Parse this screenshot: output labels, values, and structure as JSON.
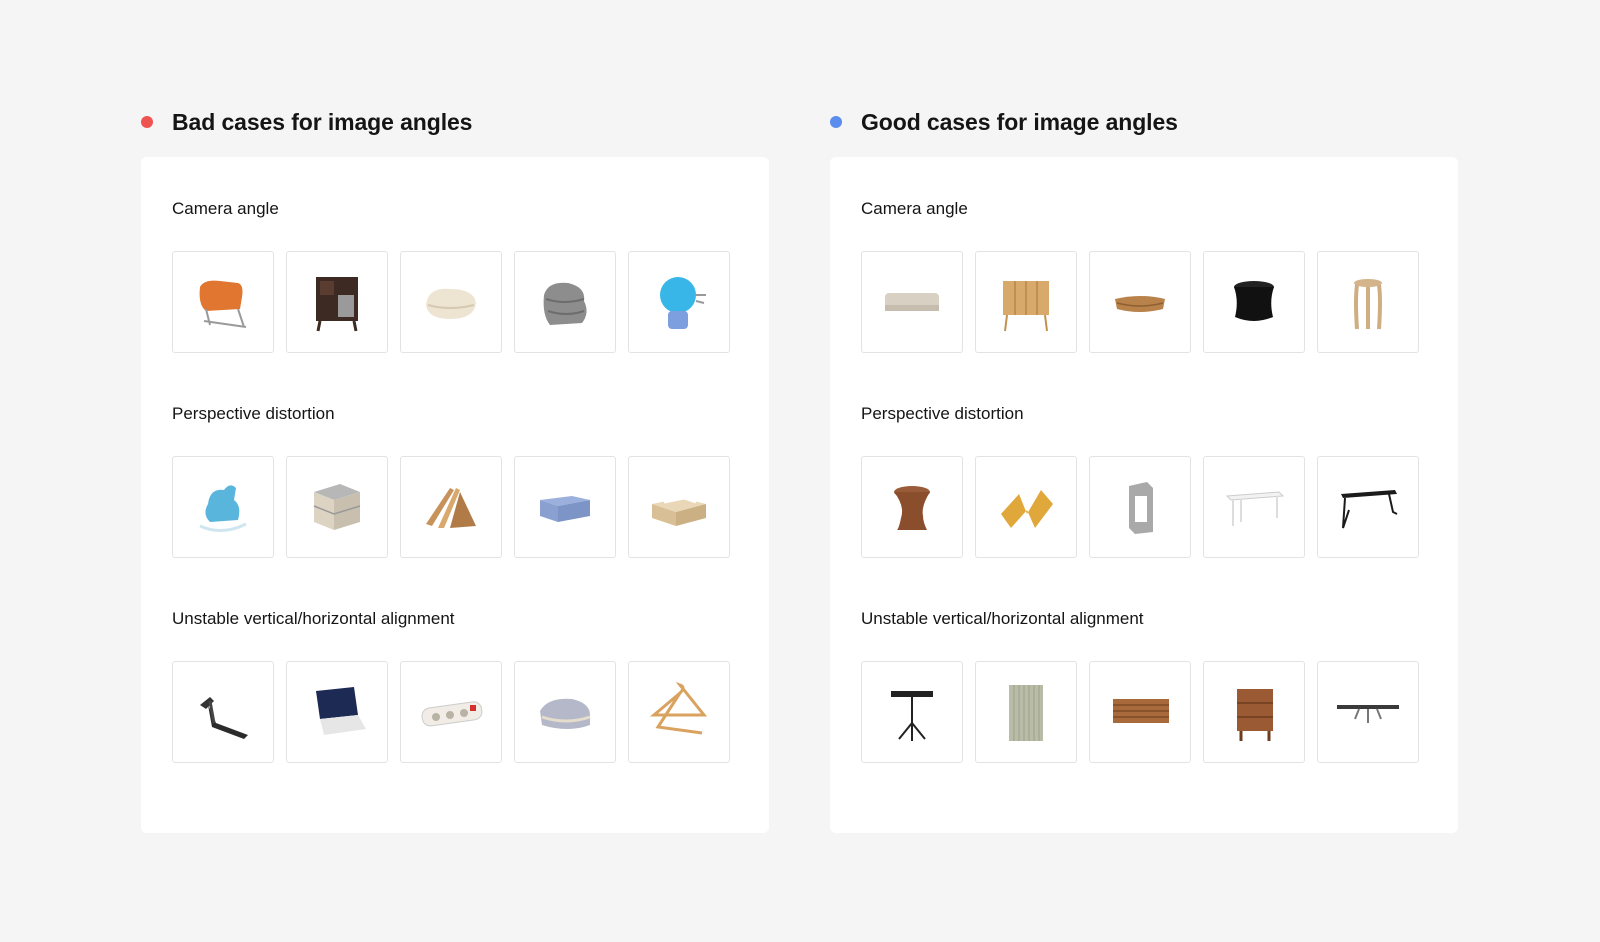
{
  "bad": {
    "title": "Bad cases for image angles",
    "dot_color": "#ef5350",
    "sections": [
      {
        "label": "Camera angle",
        "items": [
          "orange-lounge-chair-icon",
          "dark-wood-cabinet-icon",
          "folded-blanket-icon",
          "rolled-grey-blanket-icon",
          "blue-plugin-diffuser-icon"
        ]
      },
      {
        "label": "Perspective distortion",
        "items": [
          "blue-rocking-horse-icon",
          "mattress-stack-icon",
          "wood-planks-icon",
          "blue-bed-skirt-icon",
          "wooden-box-bed-icon"
        ]
      },
      {
        "label": "Unstable vertical/horizontal alignment",
        "items": [
          "treadmill-icon",
          "laptop-icon",
          "power-strip-icon",
          "folded-towel-icon",
          "clothes-hanger-icon"
        ]
      }
    ]
  },
  "good": {
    "title": "Good cases for image angles",
    "dot_color": "#5b8def",
    "sections": [
      {
        "label": "Camera angle",
        "items": [
          "beige-sofa-icon",
          "wooden-sideboard-icon",
          "woven-tray-icon",
          "black-stool-icon",
          "wood-stool-icon"
        ]
      },
      {
        "label": "Perspective distortion",
        "items": [
          "wood-side-table-icon",
          "folded-panel-icon",
          "metal-frame-icon",
          "white-bench-icon",
          "black-desk-icon"
        ]
      },
      {
        "label": "Unstable vertical/horizontal alignment",
        "items": [
          "black-bistro-table-icon",
          "ribbed-panel-icon",
          "slatted-cabinet-icon",
          "wood-nightstand-icon",
          "long-dining-table-icon"
        ]
      }
    ]
  }
}
